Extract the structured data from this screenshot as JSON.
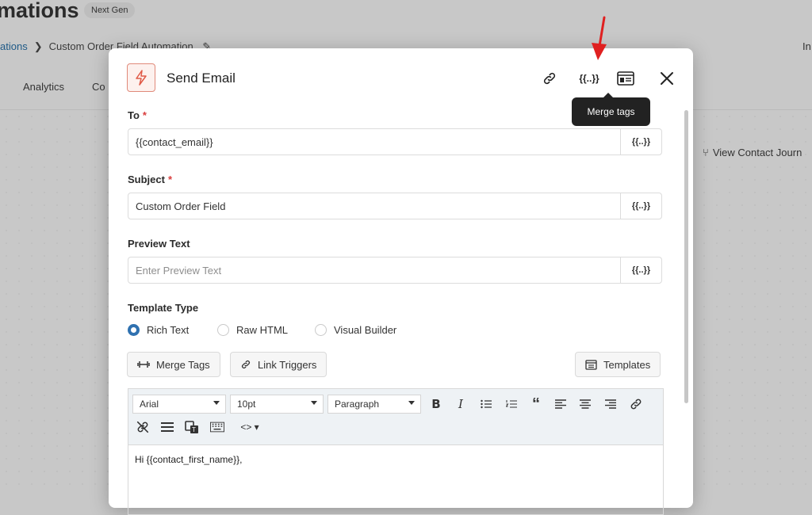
{
  "background": {
    "title": "mations",
    "badge": "Next Gen",
    "breadcrumb": {
      "parent": "ations",
      "current": "Custom Order Field Automation"
    },
    "right_text": "In",
    "tabs": [
      "Analytics",
      "Co"
    ],
    "journey_link": "View Contact Journ"
  },
  "modal": {
    "title": "Send Email",
    "tooltip": "Merge tags",
    "merge_tag_symbol": "{{..}}",
    "fields": {
      "to": {
        "label": "To",
        "required": "*",
        "value": "{{contact_email}}"
      },
      "subject": {
        "label": "Subject",
        "required": "*",
        "value": "Custom Order Field"
      },
      "preview": {
        "label": "Preview Text",
        "placeholder": "Enter Preview Text"
      }
    },
    "template_type": {
      "label": "Template Type",
      "options": [
        "Rich Text",
        "Raw HTML",
        "Visual Builder"
      ],
      "selected": "Rich Text"
    },
    "buttons": {
      "merge_tags": "Merge Tags",
      "link_triggers": "Link Triggers",
      "templates": "Templates"
    },
    "editor": {
      "font": "Arial",
      "size": "10pt",
      "block": "Paragraph",
      "content": "Hi {{contact_first_name}},"
    }
  },
  "colors": {
    "accent": "#2f71b0",
    "icon_red": "#e05a47",
    "arrow_red": "#e02020"
  }
}
